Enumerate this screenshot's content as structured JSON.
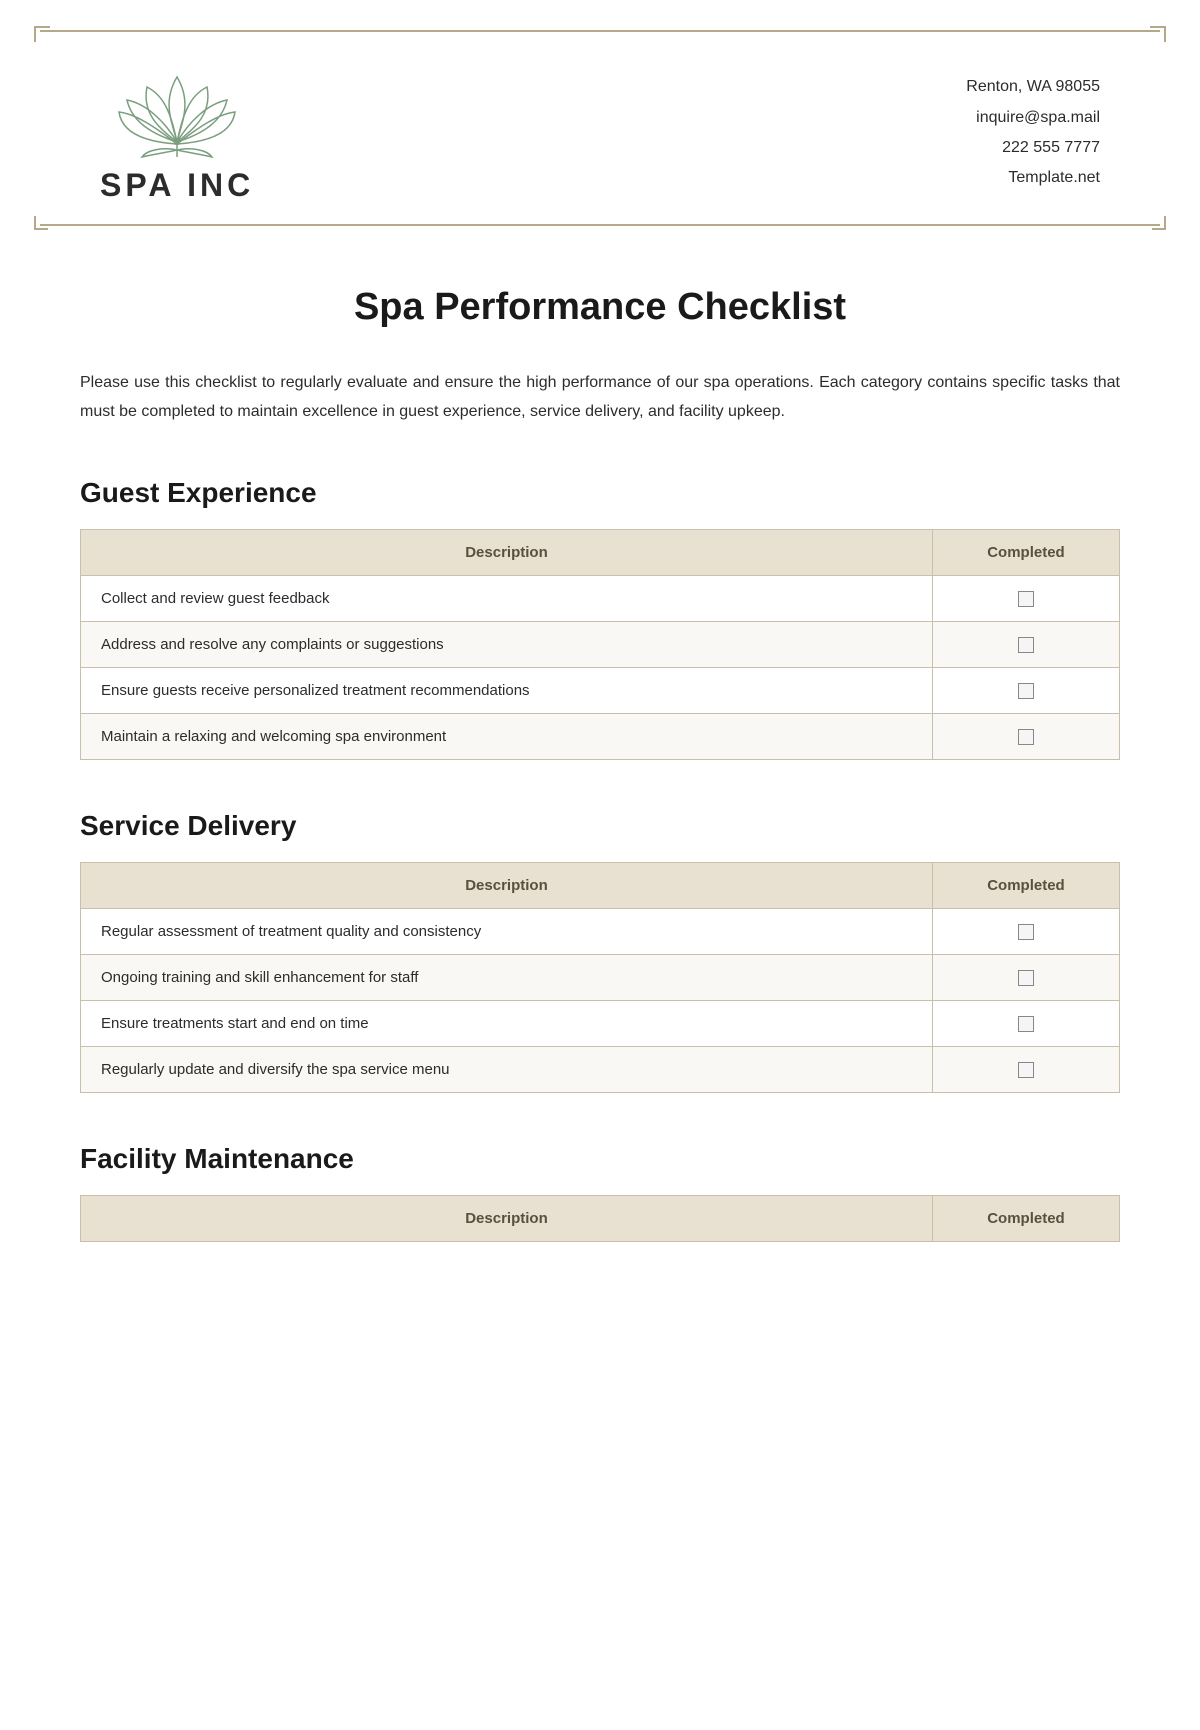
{
  "header": {
    "company_name": "SPA INC",
    "address": "Renton, WA 98055",
    "email": "inquire@spa.mail",
    "phone": "222 555 7777",
    "website": "Template.net"
  },
  "page_title": "Spa Performance Checklist",
  "intro": "Please use this checklist to regularly evaluate and ensure the high performance of our spa operations. Each category contains specific tasks that must be completed to maintain excellence in guest experience, service delivery, and facility upkeep.",
  "sections": [
    {
      "title": "Guest Experience",
      "col_desc": "Description",
      "col_completed": "Completed",
      "items": [
        {
          "desc": "Collect and review guest feedback"
        },
        {
          "desc": "Address and resolve any complaints or suggestions"
        },
        {
          "desc": "Ensure guests receive personalized treatment recommendations"
        },
        {
          "desc": "Maintain a relaxing and welcoming spa environment"
        }
      ]
    },
    {
      "title": "Service Delivery",
      "col_desc": "Description",
      "col_completed": "Completed",
      "items": [
        {
          "desc": "Regular assessment of treatment quality and consistency"
        },
        {
          "desc": "Ongoing training and skill enhancement for staff"
        },
        {
          "desc": "Ensure treatments start and end on time"
        },
        {
          "desc": "Regularly update and diversify the spa service menu"
        }
      ]
    },
    {
      "title": "Facility Maintenance",
      "col_desc": "Description",
      "col_completed": "Completed",
      "items": []
    }
  ]
}
